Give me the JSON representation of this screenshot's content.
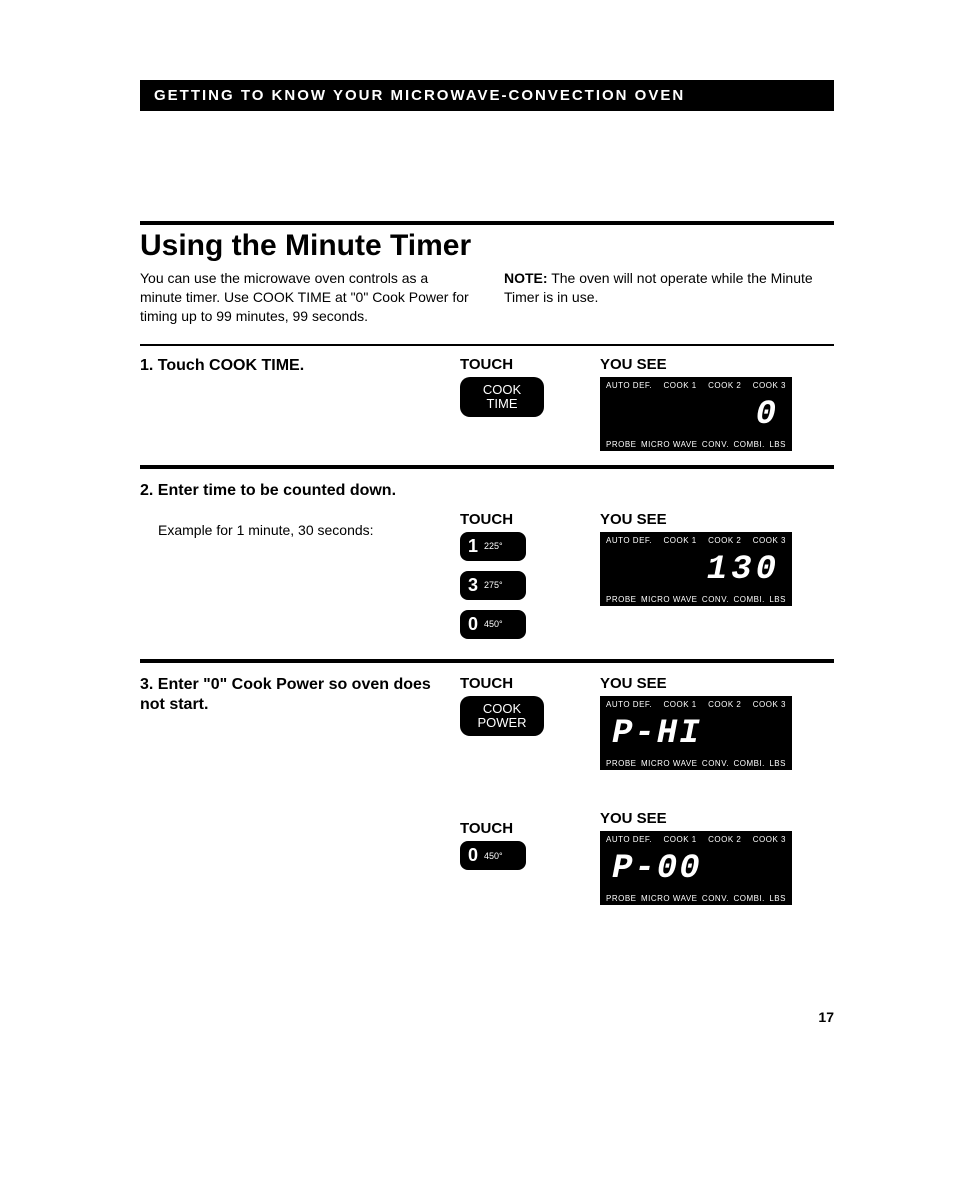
{
  "header_bar": "GETTING TO KNOW YOUR MICROWAVE-CONVECTION OVEN",
  "title": "Using the Minute Timer",
  "intro_left": "You can use the microwave oven controls as a minute timer. Use COOK TIME at \"0\" Cook Power for timing up to 99 minutes, 99 seconds.",
  "intro_right_label": "NOTE:",
  "intro_right": " The oven will not operate while the Minute Timer is in use.",
  "labels": {
    "touch": "TOUCH",
    "you_see": "YOU SEE"
  },
  "display_top": [
    "AUTO DEF.",
    "COOK 1",
    "COOK 2",
    "COOK 3"
  ],
  "display_bottom": [
    "PROBE",
    "MICRO WAVE",
    "CONV.",
    "COMBI.",
    "LBS"
  ],
  "steps": [
    {
      "num": "1.",
      "text": "Touch COOK TIME.",
      "sub": "",
      "touch_keys": [
        {
          "type": "label",
          "line1": "COOK",
          "line2": "TIME"
        }
      ],
      "display": "0"
    },
    {
      "num": "2.",
      "text": "Enter time to be counted down.",
      "sub": "Example for 1 minute, 30 seconds:",
      "touch_keys": [
        {
          "type": "num",
          "big": "1",
          "sm": "225°"
        },
        {
          "type": "num",
          "big": "3",
          "sm": "275°"
        },
        {
          "type": "num",
          "big": "0",
          "sm": "450°"
        }
      ],
      "display": "130"
    },
    {
      "num": "3.",
      "text": "Enter \"0\" Cook Power so oven does not start.",
      "sub": "",
      "groups": [
        {
          "touch_keys": [
            {
              "type": "label",
              "line1": "COOK",
              "line2": "POWER"
            }
          ],
          "display": "P-HI"
        },
        {
          "touch_keys": [
            {
              "type": "num",
              "big": "0",
              "sm": "450°"
            }
          ],
          "display": "P-00"
        }
      ]
    }
  ],
  "page_number": "17"
}
